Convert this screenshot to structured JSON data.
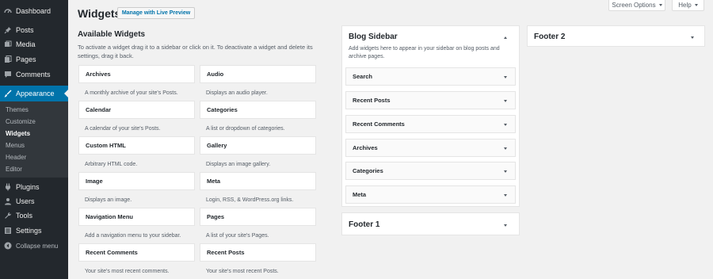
{
  "menu": {
    "items": [
      {
        "label": "Dashboard",
        "icon": "dashboard-icon"
      },
      {
        "label": "Posts",
        "icon": "pin-icon"
      },
      {
        "label": "Media",
        "icon": "media-icon"
      },
      {
        "label": "Pages",
        "icon": "pages-icon"
      },
      {
        "label": "Comments",
        "icon": "comment-icon"
      },
      {
        "label": "Appearance",
        "icon": "brush-icon"
      },
      {
        "label": "Plugins",
        "icon": "plugin-icon"
      },
      {
        "label": "Users",
        "icon": "users-icon"
      },
      {
        "label": "Tools",
        "icon": "wrench-icon"
      },
      {
        "label": "Settings",
        "icon": "settings-icon"
      },
      {
        "label": "Collapse menu",
        "icon": "collapse-icon"
      }
    ],
    "submenu": [
      "Themes",
      "Customize",
      "Widgets",
      "Menus",
      "Header",
      "Editor"
    ]
  },
  "top_tabs": {
    "screen_options": "Screen Options",
    "help": "Help"
  },
  "header": {
    "title": "Widgets",
    "preview_button": "Manage with Live Preview"
  },
  "available": {
    "heading": "Available Widgets",
    "description": "To activate a widget drag it to a sidebar or click on it. To deactivate a widget and delete its settings, drag it back.",
    "widgets": [
      {
        "name": "Archives",
        "desc": "A monthly archive of your site's Posts."
      },
      {
        "name": "Audio",
        "desc": "Displays an audio player."
      },
      {
        "name": "Calendar",
        "desc": "A calendar of your site's Posts."
      },
      {
        "name": "Categories",
        "desc": "A list or dropdown of categories."
      },
      {
        "name": "Custom HTML",
        "desc": "Arbitrary HTML code."
      },
      {
        "name": "Gallery",
        "desc": "Displays an image gallery."
      },
      {
        "name": "Image",
        "desc": "Displays an image."
      },
      {
        "name": "Meta",
        "desc": "Login, RSS, & WordPress.org links."
      },
      {
        "name": "Navigation Menu",
        "desc": "Add a navigation menu to your sidebar."
      },
      {
        "name": "Pages",
        "desc": "A list of your site's Pages."
      },
      {
        "name": "Recent Comments",
        "desc": "Your site's most recent comments."
      },
      {
        "name": "Recent Posts",
        "desc": "Your site's most recent Posts."
      }
    ]
  },
  "blog_sidebar": {
    "title": "Blog Sidebar",
    "description": "Add widgets here to appear in your sidebar on blog posts and archive pages.",
    "widgets": [
      "Search",
      "Recent Posts",
      "Recent Comments",
      "Archives",
      "Categories",
      "Meta"
    ]
  },
  "footer1": {
    "title": "Footer 1"
  },
  "footer2": {
    "title": "Footer 2"
  },
  "colors": {
    "sidebar_bg": "#23282d",
    "submenu_bg": "#32373c",
    "accent": "#0073aa",
    "page_bg": "#f1f1f1"
  }
}
